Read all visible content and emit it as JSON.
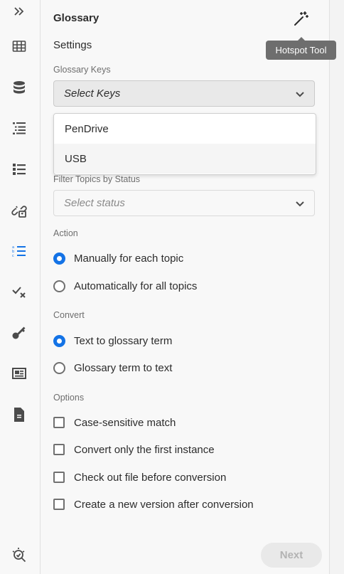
{
  "rail": {
    "items": [
      {
        "name": "expand-icon"
      },
      {
        "name": "table-grid-icon"
      },
      {
        "name": "database-icon"
      },
      {
        "name": "toc-list-icon"
      },
      {
        "name": "bullet-list-icon"
      },
      {
        "name": "broken-link-icon"
      },
      {
        "name": "glossary-list-icon",
        "active": true
      },
      {
        "name": "check-cross-icon"
      },
      {
        "name": "key-icon"
      },
      {
        "name": "image-card-icon"
      },
      {
        "name": "document-icon"
      },
      {
        "name": "search-settings-icon"
      }
    ]
  },
  "panel": {
    "title": "Glossary",
    "tooltip": "Hotspot Tool",
    "settings_label": "Settings",
    "keys_label": "Glossary Keys",
    "keys_placeholder": "Select Keys",
    "keys_options": [
      "PenDrive",
      "USB"
    ],
    "status_label": "Filter Topics by Status",
    "status_placeholder": "Select status",
    "action_label": "Action",
    "action_options": [
      {
        "label": "Manually for each topic",
        "selected": true
      },
      {
        "label": "Automatically for all topics",
        "selected": false
      }
    ],
    "convert_label": "Convert",
    "convert_options": [
      {
        "label": "Text to glossary term",
        "selected": true
      },
      {
        "label": "Glossary term to text",
        "selected": false
      }
    ],
    "options_label": "Options",
    "checkboxes": [
      {
        "label": "Case-sensitive match",
        "checked": false
      },
      {
        "label": "Convert only the first instance",
        "checked": false
      },
      {
        "label": "Check out file before conversion",
        "checked": false
      },
      {
        "label": "Create a new version after conversion",
        "checked": false
      }
    ],
    "next_label": "Next"
  },
  "colors": {
    "accent": "#1473e6",
    "disabled_button_bg": "#e9e9e9",
    "disabled_button_text": "#b3b3b3"
  }
}
